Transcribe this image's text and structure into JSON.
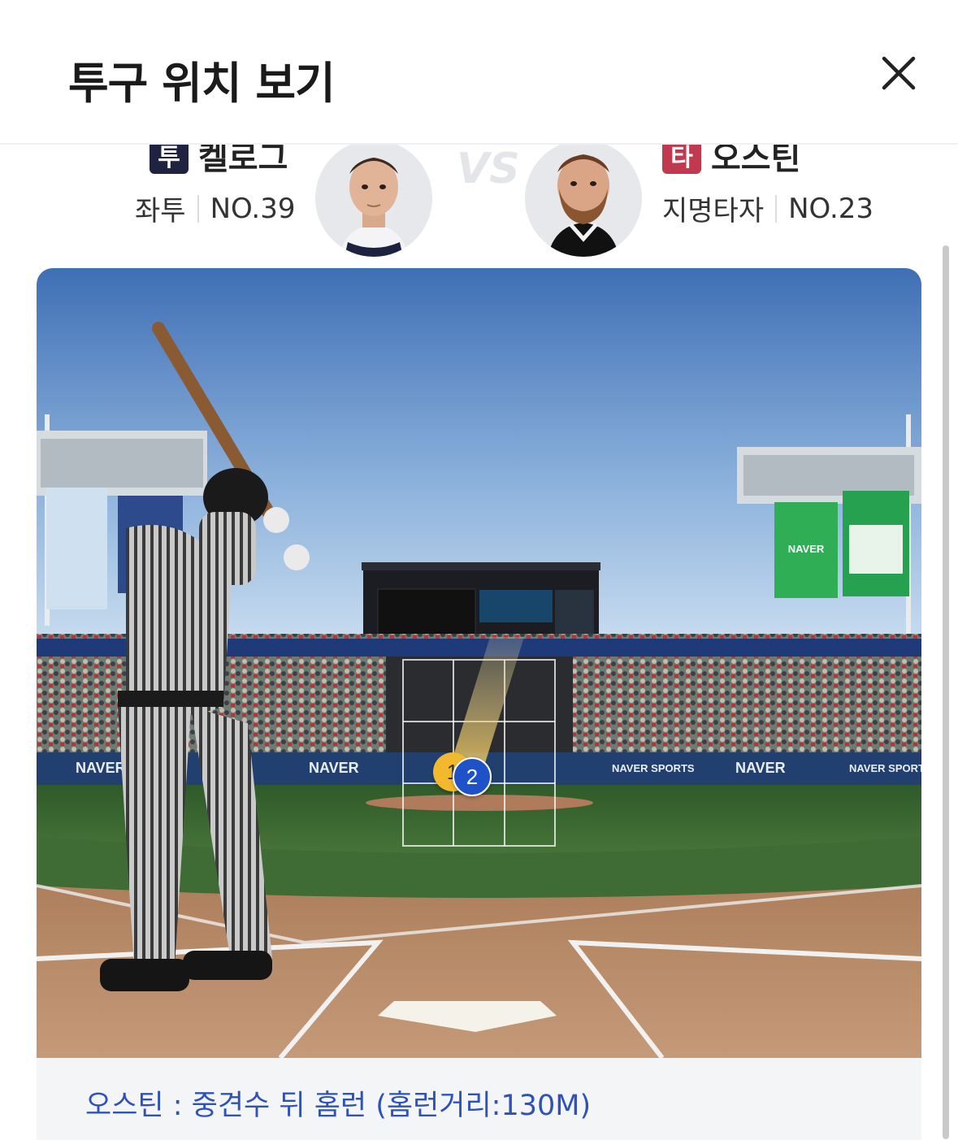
{
  "header": {
    "title": "투구 위치 보기"
  },
  "pitcher": {
    "role_badge": "투",
    "name": "켈로그",
    "throws": "좌투",
    "number": "NO.39"
  },
  "vs_label": "VS",
  "batter": {
    "role_badge": "타",
    "name": "오스틴",
    "position": "지명타자",
    "number": "NO.23"
  },
  "field": {
    "pitches": [
      {
        "label": "1",
        "color": "#f2b92f"
      },
      {
        "label": "2",
        "color": "#1f52c8"
      }
    ],
    "ads": [
      "NAVER",
      "NAVER SPORTS",
      "NAVER",
      "NAVER SPORTS",
      "NAVER",
      "NAVER SPORTS"
    ]
  },
  "result": {
    "caption": "오스틴 : 중견수 뒤 홈런 (홈런거리:130M)"
  },
  "colors": {
    "pitcher_badge": "#1f2340",
    "batter_badge": "#c0394f",
    "caption_text": "#2e52b8"
  }
}
